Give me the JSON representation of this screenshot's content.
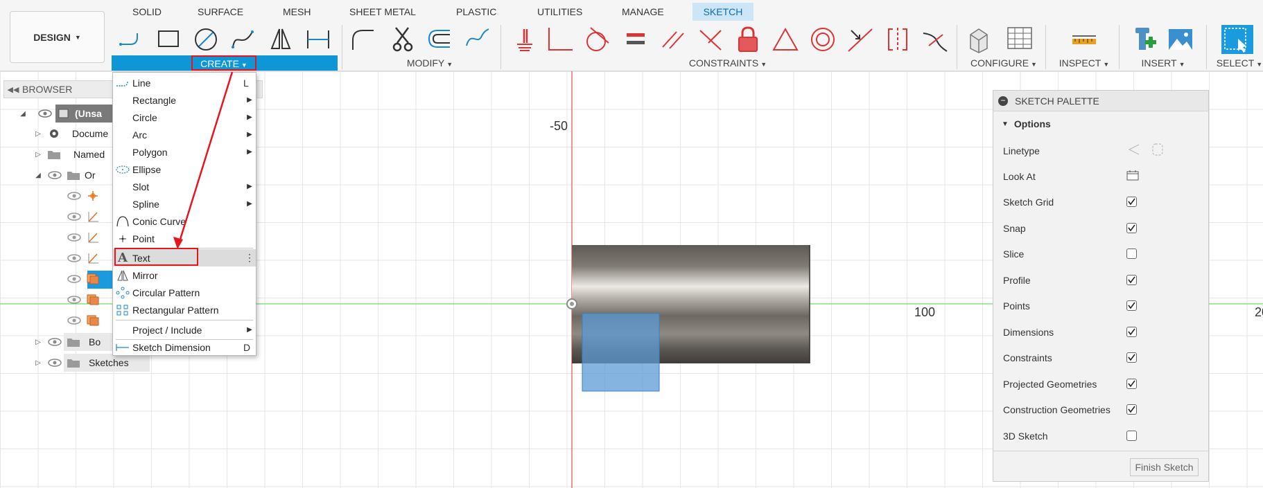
{
  "workspace": {
    "label": "DESIGN"
  },
  "tabs": [
    {
      "label": "SOLID"
    },
    {
      "label": "SURFACE"
    },
    {
      "label": "MESH"
    },
    {
      "label": "SHEET METAL"
    },
    {
      "label": "PLASTIC"
    },
    {
      "label": "UTILITIES"
    },
    {
      "label": "MANAGE"
    },
    {
      "label": "SKETCH",
      "active": true
    }
  ],
  "groups": {
    "create": "CREATE",
    "modify": "MODIFY",
    "constraints": "CONSTRAINTS",
    "configure": "CONFIGURE",
    "inspect": "INSPECT",
    "insert": "INSERT",
    "select": "SELECT"
  },
  "tool_icons": [
    "line-icon",
    "rectangle-icon",
    "circle-icon",
    "spline-icon",
    "mirror-icon",
    "dimension-icon",
    "fillet-icon",
    "trim-icon",
    "offset-icon",
    "extend-icon",
    "fix-icon",
    "perpendicular-icon",
    "tangent-icon",
    "equal-icon",
    "parallel-icon",
    "coincident-icon",
    "lock-icon",
    "triangle-icon",
    "concentric-icon",
    "midpoint-icon",
    "symmetry-icon",
    "curvature-icon",
    "configure-table-icon",
    "measure-icon",
    "insert-derive-icon",
    "insert-image-icon",
    "select-icon"
  ],
  "browser": {
    "title": "BROWSER",
    "root_label": "(Unsa",
    "rows": [
      {
        "label": "Docume",
        "icon": "gear-icon",
        "expanded": false
      },
      {
        "label": "Named",
        "icon": "folder-icon",
        "expanded": false
      },
      {
        "label": "Or",
        "icon": "folder-icon",
        "expanded": true
      },
      {
        "label": "Bo",
        "icon": "folder-icon",
        "expanded": false
      },
      {
        "label": "Sketches",
        "icon": "folder-icon",
        "expanded": false
      }
    ]
  },
  "create_menu": {
    "items": [
      {
        "label": "Line",
        "shortcut": "L",
        "submenu": false,
        "icon": "line-icon"
      },
      {
        "label": "Rectangle",
        "submenu": true
      },
      {
        "label": "Circle",
        "submenu": true
      },
      {
        "label": "Arc",
        "submenu": true
      },
      {
        "label": "Polygon",
        "submenu": true
      },
      {
        "label": "Ellipse",
        "submenu": false,
        "icon": "ellipse-icon"
      },
      {
        "label": "Slot",
        "submenu": true
      },
      {
        "label": "Spline",
        "submenu": true
      },
      {
        "label": "Conic Curve",
        "submenu": false,
        "icon": "conic-curve-icon"
      },
      {
        "label": "Point",
        "submenu": false,
        "icon": "point-icon"
      },
      {
        "label": "Text",
        "submenu": false,
        "icon": "text-icon",
        "highlighted": true
      },
      {
        "label": "Mirror",
        "submenu": false,
        "icon": "mirror-icon"
      },
      {
        "label": "Circular Pattern",
        "submenu": false,
        "icon": "circular-pattern-icon"
      },
      {
        "label": "Rectangular Pattern",
        "submenu": false,
        "icon": "rectangular-pattern-icon"
      },
      {
        "label": "Project / Include",
        "submenu": true
      },
      {
        "label": "Sketch Dimension",
        "shortcut": "D",
        "submenu": false,
        "icon": "sketch-dimension-icon"
      }
    ]
  },
  "canvas": {
    "axis_labels": [
      "-50",
      "100",
      "20"
    ],
    "colors": {
      "x_axis": "#6fdc6f",
      "y_axis": "#e54b4b",
      "profile": "#5c9bd5"
    }
  },
  "palette": {
    "title": "SKETCH PALETTE",
    "section": "Options",
    "options": [
      {
        "label": "Linetype",
        "type": "linetype"
      },
      {
        "label": "Look At",
        "type": "button"
      },
      {
        "label": "Sketch Grid",
        "type": "checkbox",
        "checked": true
      },
      {
        "label": "Snap",
        "type": "checkbox",
        "checked": true
      },
      {
        "label": "Slice",
        "type": "checkbox",
        "checked": false
      },
      {
        "label": "Profile",
        "type": "checkbox",
        "checked": true
      },
      {
        "label": "Points",
        "type": "checkbox",
        "checked": true
      },
      {
        "label": "Dimensions",
        "type": "checkbox",
        "checked": true
      },
      {
        "label": "Constraints",
        "type": "checkbox",
        "checked": true
      },
      {
        "label": "Projected Geometries",
        "type": "checkbox",
        "checked": true
      },
      {
        "label": "Construction Geometries",
        "type": "checkbox",
        "checked": true
      },
      {
        "label": "3D Sketch",
        "type": "checkbox",
        "checked": false
      }
    ],
    "finish_label": "Finish Sketch"
  },
  "accent": {
    "brand_blue": "#0f96d6",
    "annotation_red": "#e8141c"
  }
}
